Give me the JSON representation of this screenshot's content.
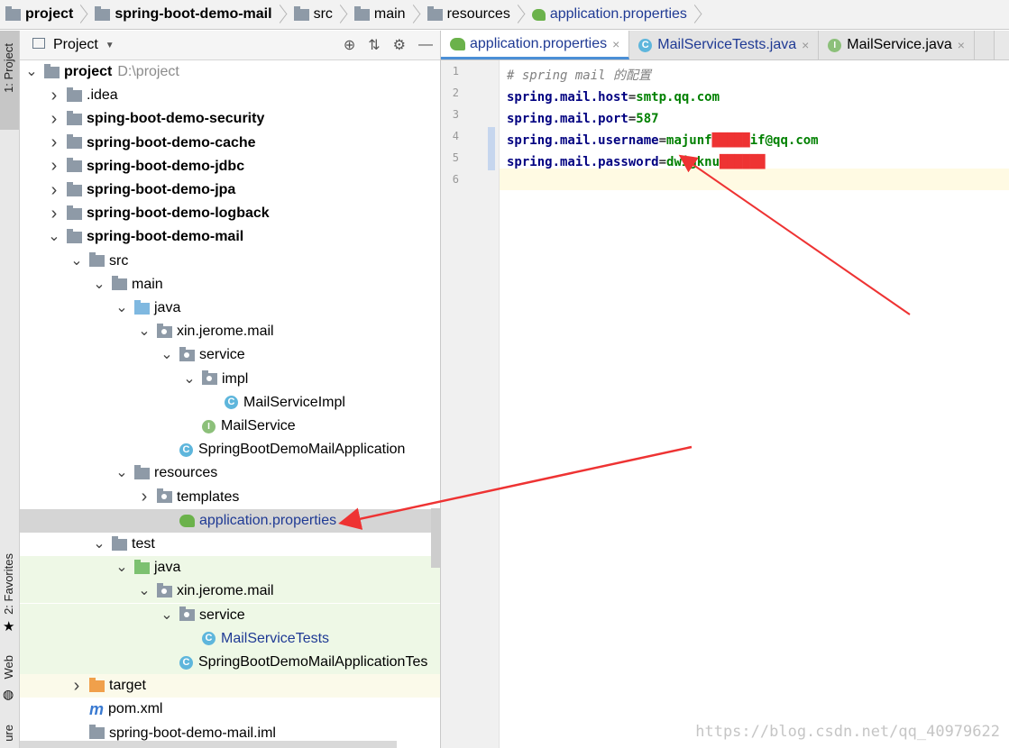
{
  "breadcrumb": [
    "project",
    "spring-boot-demo-mail",
    "src",
    "main",
    "resources",
    "application.properties"
  ],
  "tool_strip": {
    "project": "1: Project",
    "favorites": "2: Favorites",
    "web": "Web",
    "structure": "ure"
  },
  "panel": {
    "title": "Project",
    "tools": [
      "⊕",
      "⇅",
      "⚙",
      "—"
    ]
  },
  "tree": [
    {
      "label": "project",
      "extra": "D:\\project",
      "arrow": "down",
      "icon": "gray",
      "bold": true
    },
    {
      "label": ".idea",
      "arrow": "right",
      "icon": "gray"
    },
    {
      "label": "sping-boot-demo-security",
      "arrow": "right",
      "icon": "gray",
      "bold": true
    },
    {
      "label": "spring-boot-demo-cache",
      "arrow": "right",
      "icon": "gray",
      "bold": true
    },
    {
      "label": "spring-boot-demo-jdbc",
      "arrow": "right",
      "icon": "gray",
      "bold": true
    },
    {
      "label": "spring-boot-demo-jpa",
      "arrow": "right",
      "icon": "gray",
      "bold": true
    },
    {
      "label": "spring-boot-demo-logback",
      "arrow": "right",
      "icon": "gray",
      "bold": true
    },
    {
      "label": "spring-boot-demo-mail",
      "arrow": "down",
      "icon": "gray",
      "bold": true
    },
    {
      "label": "src",
      "arrow": "down",
      "icon": "gray"
    },
    {
      "label": "main",
      "arrow": "down",
      "icon": "gray"
    },
    {
      "label": "java",
      "arrow": "down",
      "icon": "blue"
    },
    {
      "label": "xin.jerome.mail",
      "arrow": "down",
      "icon": "pkg"
    },
    {
      "label": "service",
      "arrow": "down",
      "icon": "pkg"
    },
    {
      "label": "impl",
      "arrow": "down",
      "icon": "pkg"
    },
    {
      "label": "MailServiceImpl",
      "icon": "class"
    },
    {
      "label": "MailService",
      "icon": "interface"
    },
    {
      "label": "SpringBootDemoMailApplication",
      "icon": "class"
    },
    {
      "label": "resources",
      "arrow": "down",
      "icon": "gray"
    },
    {
      "label": "templates",
      "arrow": "right",
      "icon": "pkg"
    },
    {
      "label": "application.properties",
      "icon": "spring",
      "selected": true
    },
    {
      "label": "test",
      "arrow": "down",
      "icon": "gray"
    },
    {
      "label": "java",
      "arrow": "down",
      "icon": "green"
    },
    {
      "label": "xin.jerome.mail",
      "arrow": "down",
      "icon": "pkg"
    },
    {
      "label": "service",
      "arrow": "down",
      "icon": "pkg"
    },
    {
      "label": "MailServiceTests",
      "icon": "class"
    },
    {
      "label": "SpringBootDemoMailApplicationTes",
      "icon": "class"
    },
    {
      "label": "target",
      "arrow": "right",
      "icon": "orange"
    },
    {
      "label": "pom.xml",
      "icon": "maven"
    },
    {
      "label": "spring-boot-demo-mail.iml",
      "icon": "gray"
    }
  ],
  "tabs": [
    {
      "label": "application.properties",
      "active": true,
      "icon": "spring"
    },
    {
      "label": "MailServiceTests.java",
      "icon": "class"
    },
    {
      "label": "MailService.java",
      "icon": "interface"
    }
  ],
  "code": {
    "lines": [
      {
        "n": "1",
        "parts": [
          [
            "cm",
            "# spring mail 的配置"
          ]
        ]
      },
      {
        "n": "2",
        "parts": [
          [
            "k",
            "spring.mail.host"
          ],
          [
            "p",
            "="
          ],
          [
            "v",
            "smtp.qq.com"
          ]
        ]
      },
      {
        "n": "3",
        "parts": [
          [
            "k",
            "spring.mail.port"
          ],
          [
            "p",
            "="
          ],
          [
            "v",
            "587"
          ]
        ]
      },
      {
        "n": "4",
        "parts": [
          [
            "k",
            "spring.mail.username"
          ],
          [
            "p",
            "="
          ],
          [
            "v",
            "majunf"
          ],
          [
            "red",
            "█████"
          ],
          [
            "v",
            "if@qq.com"
          ]
        ]
      },
      {
        "n": "5",
        "parts": [
          [
            "k",
            "spring.mail.password"
          ],
          [
            "p",
            "="
          ],
          [
            "v",
            "d"
          ],
          [
            "v",
            "wigknu"
          ],
          [
            "red",
            "██████"
          ]
        ]
      },
      {
        "n": "6",
        "parts": []
      }
    ]
  },
  "watermark": "https://blog.csdn.net/qq_40979622",
  "colors": {
    "accent": "#4b8fd6",
    "annotation": "#ee3333"
  }
}
